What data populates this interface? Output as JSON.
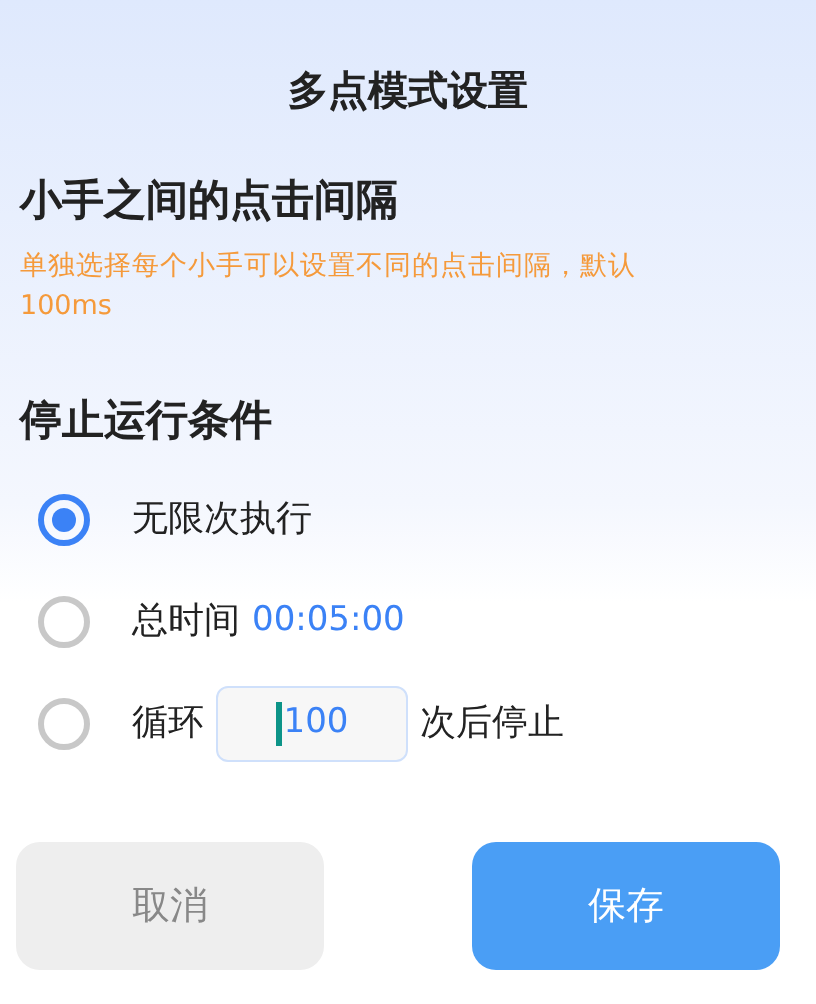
{
  "title": "多点模式设置",
  "interval": {
    "heading": "小手之间的点击间隔",
    "note": "单独选择每个小手可以设置不同的点击间隔，默认100ms"
  },
  "stop": {
    "heading": "停止运行条件",
    "options": [
      {
        "kind": "plain",
        "label": "无限次执行",
        "selected": true
      },
      {
        "kind": "time",
        "label": "总时间",
        "value": "00:05:00",
        "selected": false
      },
      {
        "kind": "loop",
        "label": "循环",
        "value": "100",
        "suffix": "次后停止",
        "selected": false
      }
    ]
  },
  "buttons": [
    {
      "kind": "cancel",
      "label": "取消"
    },
    {
      "kind": "save",
      "label": "保存"
    }
  ]
}
